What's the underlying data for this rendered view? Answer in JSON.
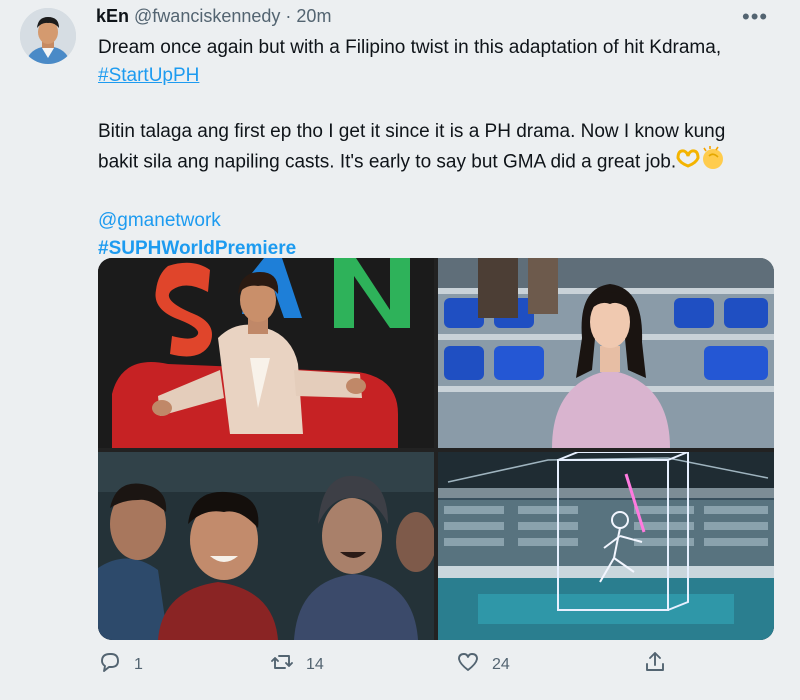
{
  "tweet": {
    "display_name": "kEn",
    "handle": "@fwanciskennedy",
    "separator": "·",
    "time": "20m",
    "more_icon": "more-horizontal-icon",
    "line1": "Dream once again but with a Filipino twist in this adaptation of hit Kdrama,",
    "hashtag_link": "#StartUpPH",
    "line2_part1": "Bitin talaga ang first ep tho I get it since it is a PH drama. Now I know kung",
    "line2_part2": "bakit sila ang napiling casts. It's early to say but GMA did a great job.",
    "mention": "@gmanetwork",
    "hashtag": "#SUPHWorldPremiere",
    "media": [
      {
        "name": "photo-man-in-red-chair"
      },
      {
        "name": "photo-woman-in-stadium-seats"
      },
      {
        "name": "photo-smiling-crowd"
      },
      {
        "name": "photo-stadium-hologram"
      }
    ],
    "actions": {
      "reply": {
        "icon": "reply-icon",
        "count": "1"
      },
      "retweet": {
        "icon": "retweet-icon",
        "count": "14"
      },
      "like": {
        "icon": "heart-icon",
        "count": "24"
      },
      "share": {
        "icon": "share-icon"
      }
    },
    "colors": {
      "link": "#1d9bf0",
      "muted": "#536471",
      "background": "#eceff1"
    }
  }
}
